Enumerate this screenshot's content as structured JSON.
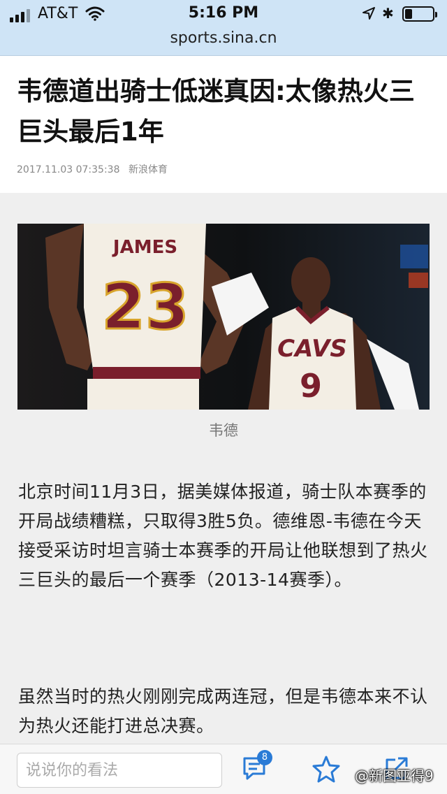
{
  "status_bar": {
    "carrier": "AT&T",
    "time": "5:16 PM",
    "signal_bars": 3,
    "signal_bars_total": 4,
    "battery_level": 0.25,
    "icons": [
      "signal-icon",
      "wifi-icon",
      "location-arrow-icon",
      "bluetooth-icon",
      "battery-icon"
    ]
  },
  "browser": {
    "url": "sports.sina.cn"
  },
  "article": {
    "title": "韦德道出骑士低迷真因:太像热火三巨头最后1年",
    "date": "2017.11.03 07:35:38",
    "source": "新浪体育",
    "image": {
      "caption": "韦德",
      "left_jersey_name": "JAMES",
      "left_jersey_number": "23",
      "right_jersey_team": "CAVS",
      "right_jersey_number": "9"
    },
    "paragraphs": [
      "北京时间11月3日，据美媒体报道，骑士队本赛季的开局战绩糟糕，只取得3胜5负。德维恩-韦德在今天接受采访时坦言骑士本赛季的开局让他联想到了热火三巨头的最后一个赛季（2013-14赛季）。",
      "虽然当时的热火刚刚完成两连冠，但是韦德本来不认为热火还能打进总决赛。"
    ]
  },
  "toolbar": {
    "comment_placeholder": "说说你的看法",
    "comment_count": "8",
    "icons": [
      "comment-icon",
      "star-icon",
      "share-icon"
    ],
    "accent_color": "#2a7bd6"
  },
  "watermark": "@新图亚得9"
}
